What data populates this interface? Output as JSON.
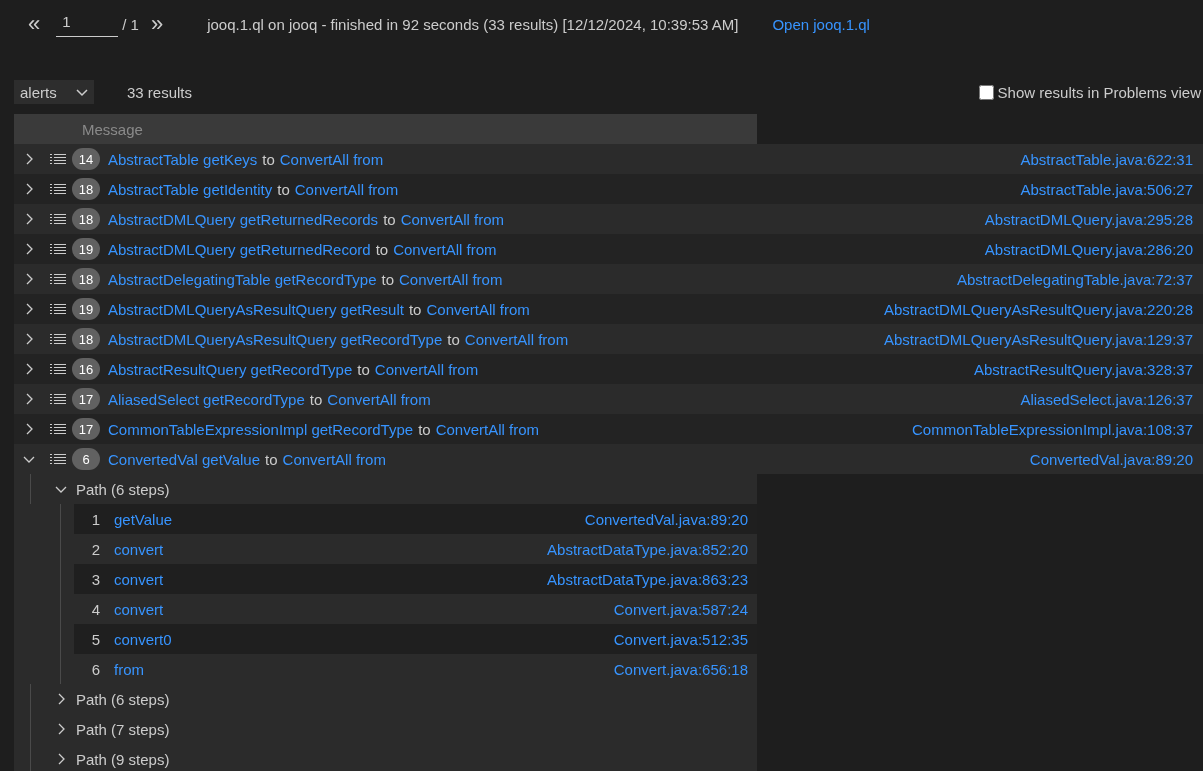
{
  "pagination": {
    "previous": "«",
    "page": "1",
    "total": "/ 1",
    "next": "»"
  },
  "query_summary": "jooq.1.ql on jooq - finished in 92 seconds (33 results) [12/12/2024, 10:39:53 AM]",
  "open_link": "Open jooq.1.ql",
  "result_set": {
    "value": "alerts"
  },
  "result_count": "33 results",
  "problems_toggle": {
    "label": "Show results in Problems view",
    "checked": false
  },
  "table": {
    "columns": [
      "Message"
    ],
    "rows": [
      {
        "expanded": false,
        "count": "14",
        "message": [
          {
            "kind": "link",
            "text": "AbstractTable getKeys"
          },
          {
            "kind": "text",
            "text": "to"
          },
          {
            "kind": "link",
            "text": "ConvertAll from"
          }
        ],
        "location": "AbstractTable.java:622:31"
      },
      {
        "expanded": false,
        "count": "18",
        "message": [
          {
            "kind": "link",
            "text": "AbstractTable getIdentity"
          },
          {
            "kind": "text",
            "text": "to"
          },
          {
            "kind": "link",
            "text": "ConvertAll from"
          }
        ],
        "location": "AbstractTable.java:506:27"
      },
      {
        "expanded": false,
        "count": "18",
        "message": [
          {
            "kind": "link",
            "text": "AbstractDMLQuery getReturnedRecords"
          },
          {
            "kind": "text",
            "text": "to"
          },
          {
            "kind": "link",
            "text": "ConvertAll from"
          }
        ],
        "location": "AbstractDMLQuery.java:295:28"
      },
      {
        "expanded": false,
        "count": "19",
        "message": [
          {
            "kind": "link",
            "text": "AbstractDMLQuery getReturnedRecord"
          },
          {
            "kind": "text",
            "text": "to"
          },
          {
            "kind": "link",
            "text": "ConvertAll from"
          }
        ],
        "location": "AbstractDMLQuery.java:286:20"
      },
      {
        "expanded": false,
        "count": "18",
        "message": [
          {
            "kind": "link",
            "text": "AbstractDelegatingTable getRecordType"
          },
          {
            "kind": "text",
            "text": "to"
          },
          {
            "kind": "link",
            "text": "ConvertAll from"
          }
        ],
        "location": "AbstractDelegatingTable.java:72:37"
      },
      {
        "expanded": false,
        "count": "19",
        "message": [
          {
            "kind": "link",
            "text": "AbstractDMLQueryAsResultQuery getResult"
          },
          {
            "kind": "text",
            "text": "to"
          },
          {
            "kind": "link",
            "text": "ConvertAll from"
          }
        ],
        "location": "AbstractDMLQueryAsResultQuery.java:220:28"
      },
      {
        "expanded": false,
        "count": "18",
        "message": [
          {
            "kind": "link",
            "text": "AbstractDMLQueryAsResultQuery getRecordType"
          },
          {
            "kind": "text",
            "text": "to"
          },
          {
            "kind": "link",
            "text": "ConvertAll from"
          }
        ],
        "location": "AbstractDMLQueryAsResultQuery.java:129:37"
      },
      {
        "expanded": false,
        "count": "16",
        "message": [
          {
            "kind": "link",
            "text": "AbstractResultQuery getRecordType"
          },
          {
            "kind": "text",
            "text": "to"
          },
          {
            "kind": "link",
            "text": "ConvertAll from"
          }
        ],
        "location": "AbstractResultQuery.java:328:37"
      },
      {
        "expanded": false,
        "count": "17",
        "message": [
          {
            "kind": "link",
            "text": "AliasedSelect getRecordType"
          },
          {
            "kind": "text",
            "text": "to"
          },
          {
            "kind": "link",
            "text": "ConvertAll from"
          }
        ],
        "location": "AliasedSelect.java:126:37"
      },
      {
        "expanded": false,
        "count": "17",
        "message": [
          {
            "kind": "link",
            "text": "CommonTableExpressionImpl getRecordType"
          },
          {
            "kind": "text",
            "text": "to"
          },
          {
            "kind": "link",
            "text": "ConvertAll from"
          }
        ],
        "location": "CommonTableExpressionImpl.java:108:37"
      },
      {
        "expanded": true,
        "count": "6",
        "message": [
          {
            "kind": "link",
            "text": "ConvertedVal getValue"
          },
          {
            "kind": "text",
            "text": "to"
          },
          {
            "kind": "link",
            "text": "ConvertAll from"
          }
        ],
        "location": "ConvertedVal.java:89:20",
        "paths": [
          {
            "label": "Path (6 steps)",
            "expanded": true,
            "steps": [
              {
                "index": "1",
                "name": "getValue",
                "location": "ConvertedVal.java:89:20"
              },
              {
                "index": "2",
                "name": "convert",
                "location": "AbstractDataType.java:852:20"
              },
              {
                "index": "3",
                "name": "convert",
                "location": "AbstractDataType.java:863:23"
              },
              {
                "index": "4",
                "name": "convert",
                "location": "Convert.java:587:24"
              },
              {
                "index": "5",
                "name": "convert0",
                "location": "Convert.java:512:35"
              },
              {
                "index": "6",
                "name": "from",
                "location": "Convert.java:656:18"
              }
            ]
          },
          {
            "label": "Path (6 steps)",
            "expanded": false
          },
          {
            "label": "Path (7 steps)",
            "expanded": false
          },
          {
            "label": "Path (9 steps)",
            "expanded": false
          }
        ]
      }
    ]
  }
}
